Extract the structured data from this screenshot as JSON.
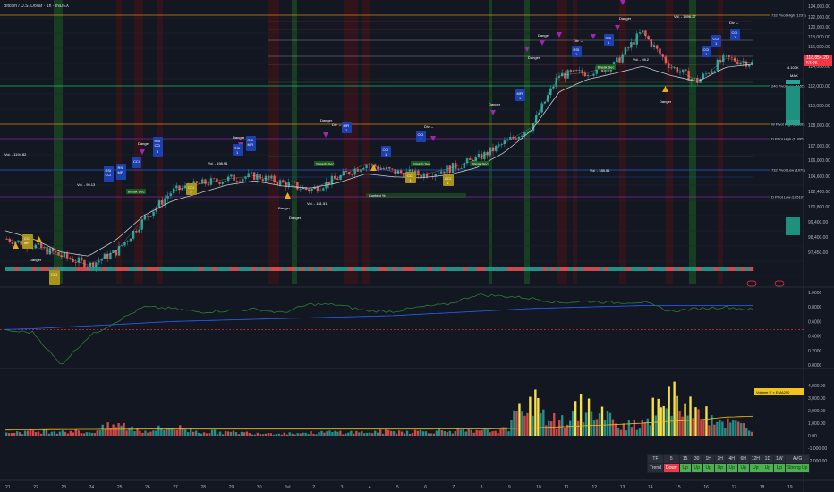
{
  "header": {
    "title": "Bitcoin / U.S. Dollar · 1h · INDEX"
  },
  "colors": {
    "background": "#131722",
    "up": "#26a69a",
    "down": "#ef5350",
    "ma": "#d1d4dc",
    "green_line": "#4caf50",
    "blue_line": "#2962ff",
    "volume_ma": "#f0c419",
    "danger": "#9c27b0",
    "level_orange": "#ff9800",
    "level_green": "#00e676",
    "level_red": "#f23645",
    "cci_badge": "#1e3a8a",
    "yellow_badge": "#b8a11a"
  },
  "price_axis": {
    "labels": [
      "124,000.00",
      "122,000.00",
      "120,000.00",
      "118,000.00",
      "116,000.00",
      "114,000.00",
      "112,000.00",
      "110,000.00",
      "108,000.00",
      "107,000.00",
      "106,000.00",
      "104,600.00",
      "102,400.00",
      "100,800.00",
      "99,400.00",
      "98,400.00",
      "97,450.00"
    ],
    "current_price": "118,854.20",
    "current_change": "53:26"
  },
  "oscillator_axis": {
    "labels": [
      "1.0000",
      "0.8000",
      "0.6000",
      "0.4000",
      "0.2000",
      "0.0000"
    ]
  },
  "volume_axis": {
    "labels": [
      "4,000.00",
      "3,000.00",
      "2,000.00",
      "1,000.00",
      "0.00",
      "-1,000.00",
      "-2,000.00"
    ],
    "legend": "Volume 5' × EMA200"
  },
  "time_axis": {
    "labels": [
      "21",
      "22",
      "23",
      "24",
      "25",
      "26",
      "27",
      "28",
      "29",
      "30",
      "Jul",
      "2",
      "3",
      "4",
      "5",
      "6",
      "7",
      "8",
      "9",
      "10",
      "11",
      "12",
      "13",
      "14",
      "15",
      "16",
      "17",
      "18",
      "19"
    ]
  },
  "levels": [
    {
      "label": "732 Pivot High (1233)",
      "color": "#ff9800"
    },
    {
      "label": "240 Pivot Low (1155)",
      "color": "#00e676"
    },
    {
      "label": "W Pivot High (11196)",
      "color": "#ff9800"
    },
    {
      "label": "D Pivot High (11095)",
      "color": "#9c27b0"
    },
    {
      "label": "732 Pivot Low (1079)",
      "color": "#2962ff"
    },
    {
      "label": "D Pivot Low (10519)",
      "color": "#9c27b0"
    }
  ],
  "annotations": {
    "danger": "Danger",
    "div": "Div ↔",
    "break_sec": "Break Sec",
    "smash_sec": "Smash Sec",
    "contest": "Contest %",
    "vol_a": "Vol. - 1496.27",
    "vol_b": "Vol. - 198.91",
    "vol_c": "Vol. - 1194.82",
    "vol_d": "Vol. - 95.13",
    "vol_e": "Vol. - 181.51",
    "vol_f": "Vol. - 185.51",
    "vol_g": "Vol. - 98.2",
    "rsi": "RSI",
    "cci": "CCI",
    "mfi": "MFI",
    "one": "1",
    "two": "2",
    "three": "3",
    "max": "MAX",
    "four_h": "4.103K"
  },
  "trend_table": {
    "header_first": "TF",
    "timeframes": [
      "5",
      "15",
      "30",
      "1H",
      "2H",
      "4H",
      "6H",
      "12H",
      "1D",
      "1W"
    ],
    "header_last": "AVG",
    "row_label": "Trend",
    "values": [
      "Down",
      "Up",
      "Up",
      "Up",
      "Up",
      "Up",
      "Up",
      "Up",
      "Up",
      "Up"
    ],
    "avg": "Strong Up"
  },
  "chart_data": {
    "type": "candlestick",
    "title": "Bitcoin / U.S. Dollar · 1h · INDEX",
    "ylim": [
      97000,
      124500
    ],
    "x": [
      "21",
      "22",
      "23",
      "24",
      "25",
      "26",
      "27",
      "28",
      "29",
      "30",
      "Jul",
      "2",
      "3",
      "4",
      "5",
      "6",
      "7",
      "8",
      "9",
      "10",
      "11",
      "12",
      "13",
      "14",
      "15",
      "16",
      "17",
      "18"
    ],
    "close_path": [
      101500,
      100800,
      99800,
      98900,
      100300,
      103500,
      106200,
      106900,
      107400,
      107700,
      107000,
      106300,
      107500,
      108900,
      108100,
      107800,
      108400,
      109300,
      110900,
      112500,
      117600,
      117900,
      118600,
      121900,
      118600,
      117000,
      119300,
      118800
    ],
    "ma_path": [
      102300,
      101500,
      100200,
      99800,
      101400,
      103800,
      105200,
      106000,
      106800,
      107200,
      106700,
      106500,
      107000,
      107900,
      107600,
      107500,
      107800,
      108500,
      110000,
      112200,
      116000,
      117200,
      117800,
      118500,
      117600,
      117000,
      118400,
      118700
    ],
    "oscillator": {
      "ylim": [
        0,
        1
      ],
      "green": [
        0.47,
        0.45,
        0.0,
        0.39,
        0.6,
        0.8,
        0.78,
        0.73,
        0.75,
        0.77,
        0.72,
        0.84,
        0.83,
        0.75,
        0.74,
        0.8,
        0.84,
        0.97,
        0.95,
        0.92,
        0.86,
        0.88,
        0.86,
        0.87,
        0.74,
        0.78,
        0.8,
        0.76
      ],
      "blue": [
        0.49,
        0.5,
        0.52,
        0.54,
        0.56,
        0.58,
        0.6,
        0.61,
        0.62,
        0.63,
        0.64,
        0.65,
        0.66,
        0.67,
        0.68,
        0.7,
        0.72,
        0.74,
        0.76,
        0.78,
        0.79,
        0.8,
        0.81,
        0.82,
        0.82,
        0.82,
        0.82,
        0.82
      ],
      "dashed_level": 0.49
    },
    "volume": {
      "ylim": [
        0,
        4500
      ],
      "values": [
        350,
        450,
        550,
        350,
        1150,
        500,
        900,
        450,
        350,
        300,
        250,
        300,
        400,
        350,
        450,
        450,
        550,
        400,
        600,
        3450,
        1200,
        3300,
        1350,
        1350,
        4200,
        3100,
        1400,
        850
      ],
      "ema": [
        450,
        470,
        490,
        500,
        510,
        520,
        520,
        520,
        520,
        520,
        520,
        520,
        520,
        520,
        520,
        520,
        530,
        540,
        560,
        620,
        700,
        800,
        880,
        1000,
        1150,
        1250,
        1480,
        1550
      ]
    }
  }
}
